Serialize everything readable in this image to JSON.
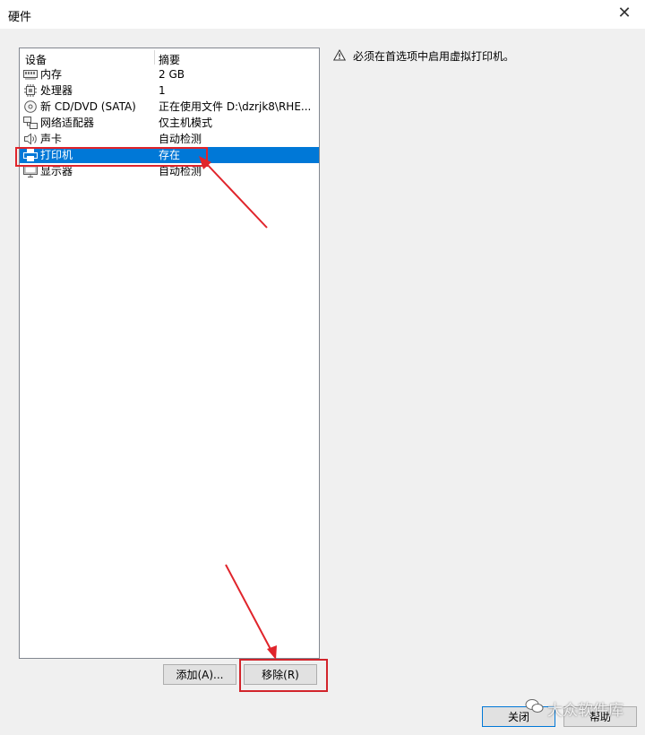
{
  "window": {
    "title": "硬件",
    "close_glyph": "✕"
  },
  "device_list": {
    "headers": {
      "device": "设备",
      "summary": "摘要"
    },
    "rows": [
      {
        "icon": "memory-icon",
        "name": "内存",
        "summary": "2 GB"
      },
      {
        "icon": "processor-icon",
        "name": "处理器",
        "summary": "1"
      },
      {
        "icon": "cd-dvd-icon",
        "name": "新 CD/DVD (SATA)",
        "summary": "正在使用文件 D:\\dzrjk8\\RHE..."
      },
      {
        "icon": "network-adapter-icon",
        "name": "网络适配器",
        "summary": "仅主机模式"
      },
      {
        "icon": "sound-card-icon",
        "name": "声卡",
        "summary": "自动检测"
      },
      {
        "icon": "printer-icon",
        "name": "打印机",
        "summary": "存在",
        "selected": true
      },
      {
        "icon": "display-icon",
        "name": "显示器",
        "summary": "自动检测"
      }
    ]
  },
  "buttons": {
    "add": "添加(A)...",
    "remove": "移除(R)",
    "close": "关闭",
    "help": "帮助"
  },
  "message": {
    "icon": "warning-icon",
    "text": "必须在首选项中启用虚拟打印机。"
  },
  "watermark": {
    "text": "大众软件库"
  },
  "colors": {
    "selection": "#0078d7",
    "highlight_box": "#e0242b"
  }
}
